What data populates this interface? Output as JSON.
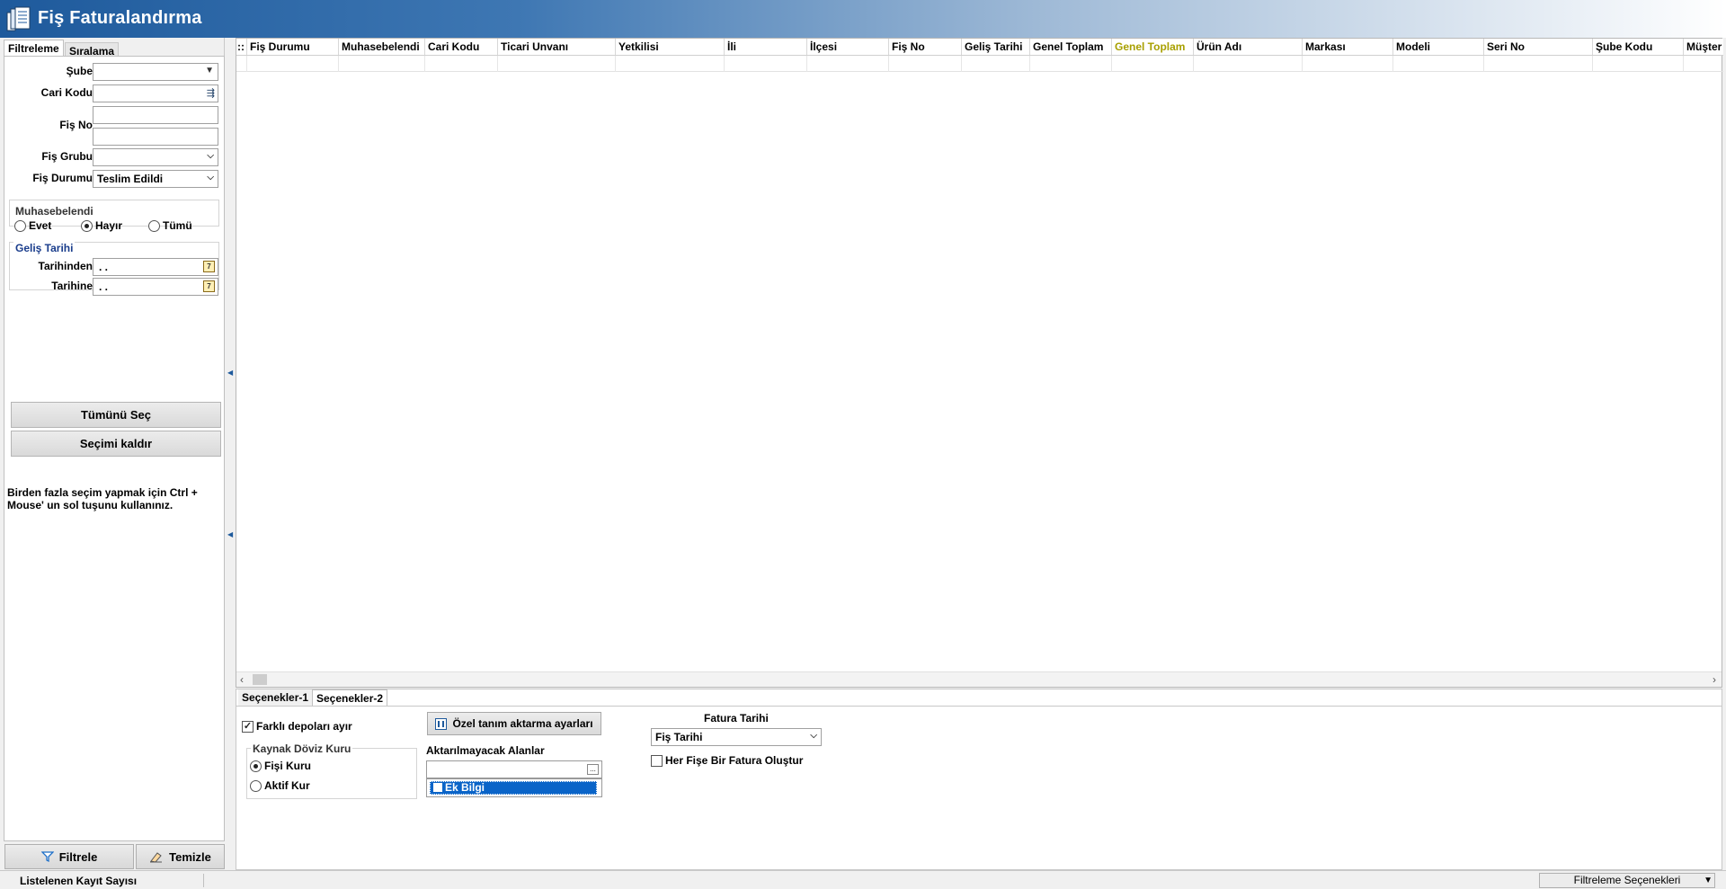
{
  "window": {
    "title": "Fiş Faturalandırma"
  },
  "left_tabs": [
    "Filtreleme",
    "Sıralama"
  ],
  "filters": {
    "sube_label": "Şube",
    "sube_value": "",
    "cari_kodu_label": "Cari Kodu",
    "cari_kodu_value": "",
    "fis_no_label": "Fiş No",
    "fis_grubu_label": "Fiş Grubu",
    "fis_durumu_label": "Fiş Durumu",
    "fis_durumu_value": "Teslim Edildi"
  },
  "muhasebelendi": {
    "title": "Muhasebelendi",
    "options": [
      "Evet",
      "Hayır",
      "Tümü"
    ],
    "selected": "Hayır"
  },
  "gelis_tarihi": {
    "title": "Geliş Tarihi",
    "from_label": "Tarihinden",
    "from_value": ". .",
    "to_label": "Tarihine",
    "to_value": ". ."
  },
  "buttons": {
    "select_all": "Tümünü Seç",
    "clear_selection": "Seçimi kaldır",
    "filter": "Filtrele",
    "clear": "Temizle"
  },
  "hint": "Birden fazla seçim yapmak için Ctrl + Mouse' un sol tuşunu kullanınız.",
  "grid": {
    "columns": [
      "Fiş Durumu",
      "Muhasebelendi",
      "Cari Kodu",
      "Ticari Unvanı",
      "Yetkilisi",
      "İli",
      "İlçesi",
      "Fiş No",
      "Geliş Tarihi",
      "Genel Toplam",
      "Genel Toplam",
      "Ürün Adı",
      "Markası",
      "Modeli",
      "Seri No",
      "Şube Kodu",
      "Müşter"
    ],
    "row_indicator": "::"
  },
  "options_tabs": [
    "Seçenekler-1",
    "Seçenekler-2"
  ],
  "options": {
    "farkli_depolar_label": "Farklı depoları ayır",
    "farkli_depolar_checked": true,
    "ozel_tanim_button": "Özel tanım aktarma ayarları",
    "kaynak_doviz_title": "Kaynak Döviz Kuru",
    "kaynak_doviz_options": [
      "Fişi Kuru",
      "Aktif Kur"
    ],
    "kaynak_doviz_selected": "Fişi Kuru",
    "aktarilmayacak_title": "Aktarılmayacak Alanlar",
    "aktarilmayacak_items": [
      "Ek Bilgi"
    ],
    "fatura_tarihi_title": "Fatura Tarihi",
    "fatura_tarihi_value": "Fiş Tarihi",
    "her_fise_label": "Her Fişe Bir Fatura Oluştur",
    "her_fise_checked": false
  },
  "status": {
    "record_count_label": "Listelenen Kayıt Sayısı",
    "filter_options": "Filtreleme Seçenekleri"
  }
}
